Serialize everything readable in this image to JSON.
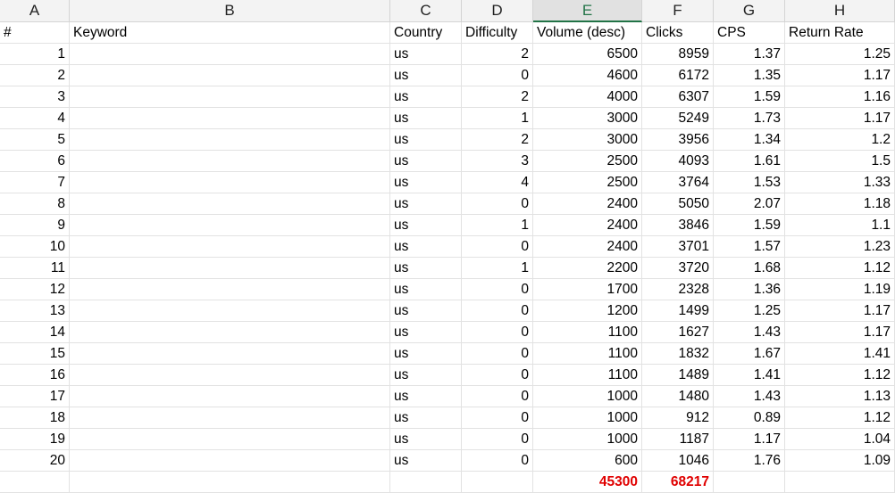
{
  "columns": [
    {
      "letter": "A"
    },
    {
      "letter": "B"
    },
    {
      "letter": "C"
    },
    {
      "letter": "D"
    },
    {
      "letter": "E"
    },
    {
      "letter": "F"
    },
    {
      "letter": "G"
    },
    {
      "letter": "H"
    }
  ],
  "active_column": "E",
  "headers": [
    "#",
    "Keyword",
    "Country",
    "Difficulty",
    "Volume (desc)",
    "Clicks",
    "CPS",
    "Return Rate"
  ],
  "rows": [
    [
      "1",
      "",
      "us",
      "2",
      "6500",
      "8959",
      "1.37",
      "1.25"
    ],
    [
      "2",
      "",
      "us",
      "0",
      "4600",
      "6172",
      "1.35",
      "1.17"
    ],
    [
      "3",
      "",
      "us",
      "2",
      "4000",
      "6307",
      "1.59",
      "1.16"
    ],
    [
      "4",
      "",
      "us",
      "1",
      "3000",
      "5249",
      "1.73",
      "1.17"
    ],
    [
      "5",
      "",
      "us",
      "2",
      "3000",
      "3956",
      "1.34",
      "1.2"
    ],
    [
      "6",
      "",
      "us",
      "3",
      "2500",
      "4093",
      "1.61",
      "1.5"
    ],
    [
      "7",
      "",
      "us",
      "4",
      "2500",
      "3764",
      "1.53",
      "1.33"
    ],
    [
      "8",
      "",
      "us",
      "0",
      "2400",
      "5050",
      "2.07",
      "1.18"
    ],
    [
      "9",
      "",
      "us",
      "1",
      "2400",
      "3846",
      "1.59",
      "1.1"
    ],
    [
      "10",
      "",
      "us",
      "0",
      "2400",
      "3701",
      "1.57",
      "1.23"
    ],
    [
      "11",
      "",
      "us",
      "1",
      "2200",
      "3720",
      "1.68",
      "1.12"
    ],
    [
      "12",
      "",
      "us",
      "0",
      "1700",
      "2328",
      "1.36",
      "1.19"
    ],
    [
      "13",
      "",
      "us",
      "0",
      "1200",
      "1499",
      "1.25",
      "1.17"
    ],
    [
      "14",
      "",
      "us",
      "0",
      "1100",
      "1627",
      "1.43",
      "1.17"
    ],
    [
      "15",
      "",
      "us",
      "0",
      "1100",
      "1832",
      "1.67",
      "1.41"
    ],
    [
      "16",
      "",
      "us",
      "0",
      "1100",
      "1489",
      "1.41",
      "1.12"
    ],
    [
      "17",
      "",
      "us",
      "0",
      "1000",
      "1480",
      "1.43",
      "1.13"
    ],
    [
      "18",
      "",
      "us",
      "0",
      "1000",
      "912",
      "0.89",
      "1.12"
    ],
    [
      "19",
      "",
      "us",
      "0",
      "1000",
      "1187",
      "1.17",
      "1.04"
    ],
    [
      "20",
      "",
      "us",
      "0",
      "600",
      "1046",
      "1.76",
      "1.09"
    ]
  ],
  "totals": {
    "volume": "45300",
    "clicks": "68217"
  },
  "colors": {
    "total_text": "#e00000",
    "active_header_accent": "#217346"
  }
}
